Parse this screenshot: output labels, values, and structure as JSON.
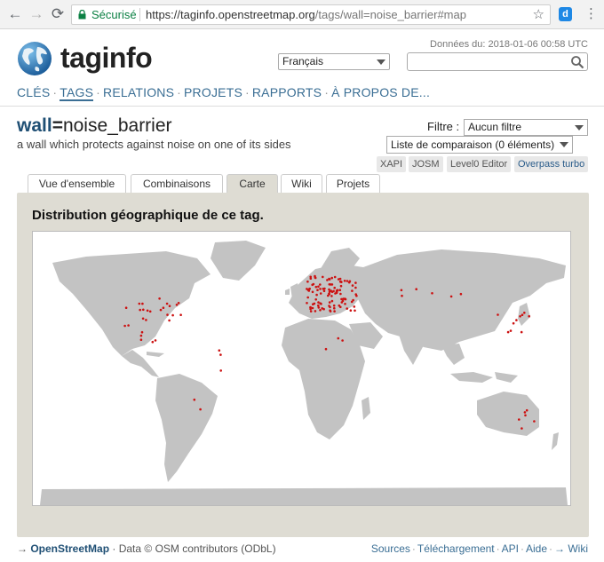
{
  "browser": {
    "secure_label": "Sécurisé",
    "url_host": "https://taginfo.openstreetmap.org",
    "url_path": "/tags/wall=noise_barrier#map",
    "extension_label": "d"
  },
  "header": {
    "date": "Données du: 2018-01-06 00:58 UTC",
    "logo_text": "taginfo",
    "language": "Français"
  },
  "menu": {
    "items": [
      "CLÉS",
      "TAGS",
      "RELATIONS",
      "PROJETS",
      "RAPPORTS",
      "À PROPOS DE..."
    ],
    "separator": "·"
  },
  "tag": {
    "key": "wall",
    "eq": "=",
    "value": "noise_barrier",
    "description": "a wall which protects against noise on one of its sides"
  },
  "filter": {
    "label": "Filtre :",
    "value": "Aucun filtre",
    "compare": "Liste de comparaison (0 éléments)"
  },
  "tools": [
    "XAPI",
    "JOSM",
    "Level0 Editor",
    "Overpass turbo"
  ],
  "tabs": [
    "Vue d'ensemble",
    "Combinaisons",
    "Carte",
    "Wiki",
    "Projets"
  ],
  "panel": {
    "title": "Distribution géographique de ce tag."
  },
  "footer": {
    "arrow": "→",
    "osm": "OpenStreetMap",
    "data": "· Data © OSM contributors (ODbL)",
    "links": [
      "Sources",
      "Téléchargement",
      "API",
      "Aide",
      "→ Wiki"
    ]
  },
  "colors": {
    "accent": "#3a6e94",
    "panel_bg": "#dedcd3",
    "land": "#c3c3c3",
    "marker": "#cc1111"
  }
}
